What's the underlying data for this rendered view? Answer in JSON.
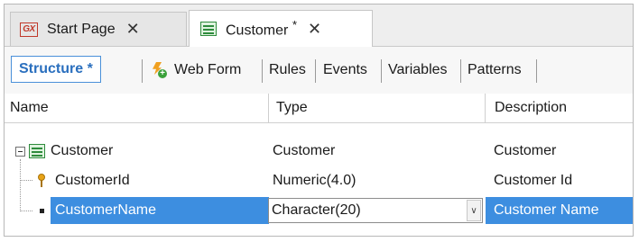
{
  "tabs": [
    {
      "icon": "gx-icon",
      "label": "Start Page",
      "close": "✕",
      "active": false
    },
    {
      "icon": "table-icon",
      "label": "Customer",
      "modified": "*",
      "close": "✕",
      "active": true
    }
  ],
  "gx_icon_text": "GX",
  "part_tabs": [
    {
      "label": "Structure *",
      "active": true
    },
    {
      "label": "Web Form",
      "icon": "web-form-icon"
    },
    {
      "label": "Rules"
    },
    {
      "label": "Events"
    },
    {
      "label": "Variables"
    },
    {
      "label": "Patterns"
    }
  ],
  "columns": {
    "name": "Name",
    "type": "Type",
    "description": "Description"
  },
  "rows": [
    {
      "name": "Customer",
      "type": "Customer",
      "description": "Customer",
      "icon": "table-icon",
      "expanded": true
    },
    {
      "name": "CustomerId",
      "type": "Numeric(4.0)",
      "description": "Customer Id",
      "icon": "key-icon"
    },
    {
      "name": "CustomerName",
      "type": "Character(20)",
      "description": "Customer Name",
      "icon": "bullet-icon",
      "selected": true
    }
  ],
  "colors": {
    "accent": "#3d8ee0",
    "structure_tab": "#2a6fbe",
    "key": "#e8a317",
    "table_icon": "#2e8b3c",
    "gx": "#c0392b"
  }
}
